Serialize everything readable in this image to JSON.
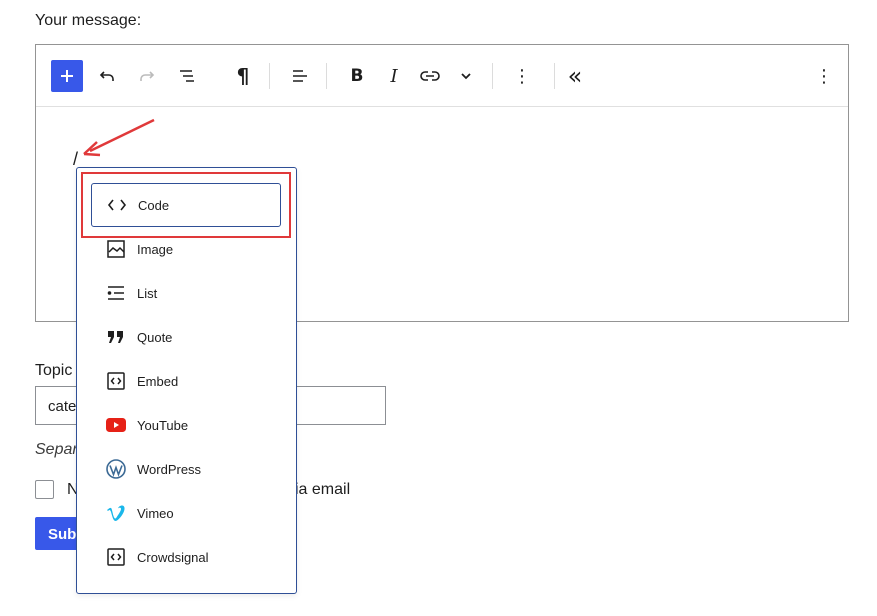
{
  "form": {
    "message_label": "Your message:",
    "topic_label_visible": "Topic",
    "topic_input_value_visible": "cate",
    "separator_hint_visible": "Separ",
    "notify_label_visible": "N",
    "notify_label_tail": "via email",
    "submit_label_visible": "Sub"
  },
  "toolbar": {
    "add_block": "+",
    "undo": "undo-icon",
    "redo": "redo-icon",
    "list_view": "list-view-icon",
    "paragraph": "¶",
    "align": "align-icon",
    "bold": "B",
    "italic": "I",
    "link": "link-icon",
    "more": "chevron-down-icon",
    "options": "⋮",
    "collapse": "«",
    "settings": "⋮"
  },
  "editor": {
    "content": "/"
  },
  "inserter": {
    "items": [
      {
        "label": "Code",
        "icon": "code-icon"
      },
      {
        "label": "Image",
        "icon": "image-icon"
      },
      {
        "label": "List",
        "icon": "list-icon"
      },
      {
        "label": "Quote",
        "icon": "quote-icon"
      },
      {
        "label": "Embed",
        "icon": "embed-icon"
      },
      {
        "label": "YouTube",
        "icon": "youtube-icon"
      },
      {
        "label": "WordPress",
        "icon": "wordpress-icon"
      },
      {
        "label": "Vimeo",
        "icon": "vimeo-icon"
      },
      {
        "label": "Crowdsignal",
        "icon": "crowdsignal-icon"
      }
    ]
  },
  "colors": {
    "accent": "#3858e9",
    "annotation": "#e0393a",
    "youtube": "#e62117",
    "vimeo": "#1ab7ea",
    "wordpress": "#3c6a95"
  }
}
